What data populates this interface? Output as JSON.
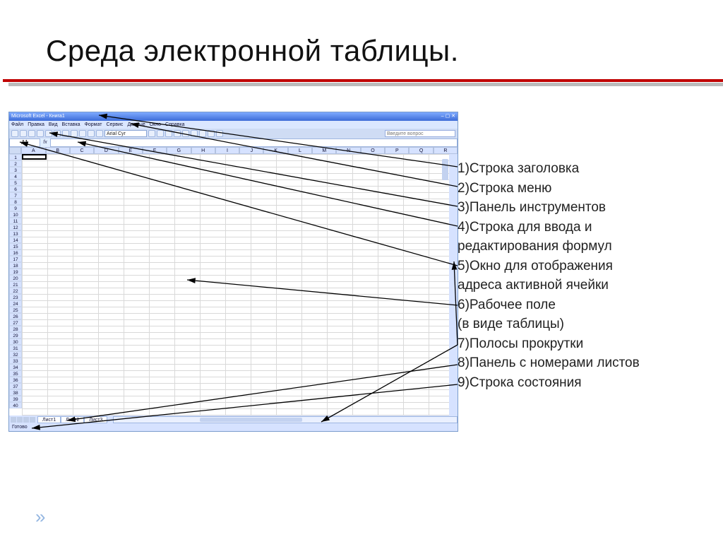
{
  "slide": {
    "title": "Среда электронной таблицы."
  },
  "excel": {
    "titlebar_text": "Microsoft Excel - Книга1",
    "menus": [
      "Файл",
      "Правка",
      "Вид",
      "Вставка",
      "Формат",
      "Сервис",
      "Данные",
      "Окно",
      "Справка"
    ],
    "font_name": "Arial Cyr",
    "help_placeholder": "Введите вопрос",
    "namebox": "A1",
    "fx_label": "fx",
    "columns": [
      "A",
      "B",
      "C",
      "D",
      "E",
      "F",
      "G",
      "H",
      "I",
      "J",
      "K",
      "L",
      "M",
      "N",
      "O",
      "P",
      "Q",
      "R"
    ],
    "row_count": 40,
    "sheets": [
      "Лист1",
      "Лист2",
      "Лист3"
    ],
    "status": "Готово"
  },
  "legend": {
    "items": [
      "1)Строка заголовка",
      "2)Строка меню",
      "3)Панель инструментов",
      "4)Строка для ввода и",
      "редактирования формул",
      "5)Окно для отображения",
      "адреса активной ячейки",
      "6)Рабочее поле",
      "(в виде таблицы)",
      "7)Полосы прокрутки",
      "8)Панель с номерами листов",
      "9)Строка состояния"
    ]
  },
  "footer_glyph": "»"
}
